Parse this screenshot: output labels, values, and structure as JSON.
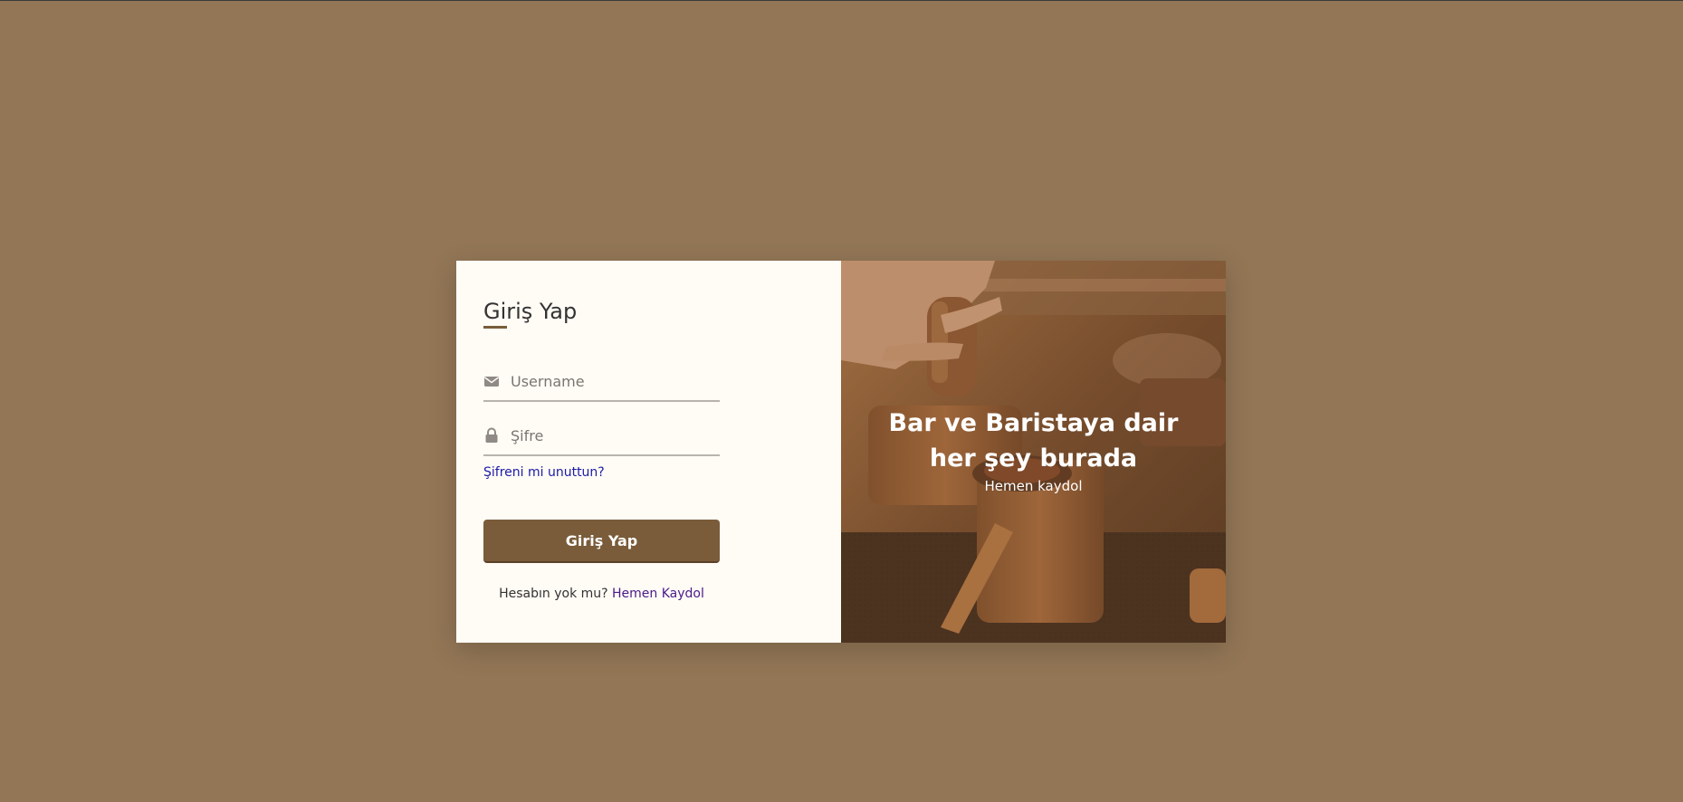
{
  "login": {
    "title": "Giriş Yap",
    "username_placeholder": "Username",
    "password_placeholder": "Şifre",
    "forgot_link": "Şifreni mi unuttun?",
    "submit_label": "Giriş Yap",
    "signup_prompt": "Hesabın yok mu?",
    "signup_link": "Hemen Kaydol"
  },
  "hero": {
    "title_line1": "Bar ve Baristaya dair",
    "title_line2": "her şey burada",
    "subtitle": "Hemen kaydol"
  },
  "icons": {
    "username": "envelope-icon",
    "password": "lock-icon"
  },
  "colors": {
    "background": "#927656",
    "panel": "#fffbf5",
    "accent": "#7a5c3a",
    "link": "#1a1aa6",
    "signup_link": "#4a1a8a"
  }
}
